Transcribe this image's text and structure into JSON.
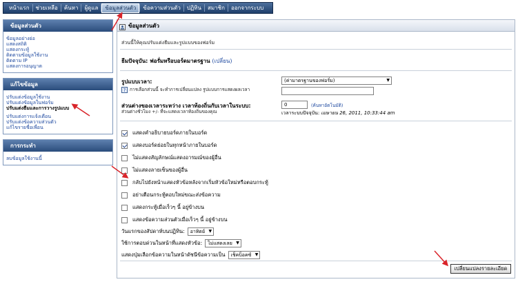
{
  "nav": {
    "items": [
      "หน้าแรก",
      "ช่วยเหลือ",
      "ค้นหา",
      "ผู้ดูแล",
      "ข้อมูลส่วนตัว",
      "ข้อความส่วนตัว",
      "ปฏิทิน",
      "สมาชิก",
      "ออกจากระบบ"
    ],
    "active_index": 4
  },
  "sidebar": {
    "box1": {
      "title": "ข้อมูลส่วนตัว",
      "links": [
        "ข้อมูลอย่างย่อ",
        "แสดงสถิติ",
        "แสดงกระทู้",
        "ติดตามข้อมูลใช้งาน",
        "ติดตาม IP",
        "แสดงการอนุญาต"
      ]
    },
    "box2": {
      "title": "แก้ไขข้อมูล",
      "links_a": [
        "ปรับแต่งข้อมูลใช้งาน",
        "ปรับแต่งข้อมูลในฟอร์ม",
        "ปรับแต่งธีมและการวางรูปแบบ"
      ],
      "links_b": [
        "ปรับแต่งการแจ้งเตือน",
        "ปรับแต่งข้อความส่วนตัว",
        "แก้ไขรายชื่อเพื่อน"
      ]
    },
    "box3": {
      "title": "การกระทำ",
      "links": [
        "ลบข้อมูลใช้งานนี้"
      ]
    }
  },
  "main": {
    "title": "ข้อมูลส่วนตัว",
    "description": "ส่วนนี้ให้คุณปรับแต่งธีมและรูปแบบของฟอร์ม",
    "current_theme_label": "ธีมปัจจุบัน: ฟอรั่มหรือบอร์ดมาตรฐาน",
    "change_link": "(เปลี่ยน)",
    "time_format": {
      "title": "รูปแบบเวลา:",
      "note": "การเลือกส่วนนี้ จะทำการเปลี่ยนแปลง รูปแบบการแสดงผลเวลา",
      "select_value": "(ค่ามาตรฐานของฟอรั่ม)",
      "text_value": ""
    },
    "offset": {
      "title": "ส่วนต่างของเวลาระหว่าง เวลาท้องถิ่นกับเวลาในระบบ:",
      "note": "ส่วนต่างชั่วโมง +/- ที่จะแสดงเวลาท้องถิ่นของคุณ",
      "value": "0",
      "autodetect": "(ค้นหาอัตโนมัติ)",
      "server_time_label": "เวลาระบบปัจจุบัน:",
      "server_time_value": "เมษายน 26, 2011, 10:33:44 am"
    },
    "checkboxes": [
      {
        "label": "แสดงคำอธิบายบอร์ดภายในบอร์ด",
        "checked": true
      },
      {
        "label": "แสดงบอร์ดย่อยในทุกหน้าภายในบอร์ด",
        "checked": true
      },
      {
        "label": "ไม่แสดงสัญลักษณ์แสดงอารมณ์ของผู้อื่น",
        "checked": false
      },
      {
        "label": "ไม่แสดงลายเซ็นของผู้อื่น",
        "checked": false
      },
      {
        "label": "กลับไปยังหน้าแสดงหัวข้อหลังจากเริ่มหัวข้อใหม่หรือตอบกระทู้",
        "checked": false
      },
      {
        "label": "อย่าเตือนกระทู้ตอบใหม่ขณะส่งข้อความ",
        "checked": false
      },
      {
        "label": "แสดงกระทู้เมื่อเร็วๆ นี้ อยู่ข้างบน",
        "checked": false
      },
      {
        "label": "แสดงข้อความส่วนตัวเมื่อเร็วๆ นี้ อยู่ข้างบน",
        "checked": false
      }
    ],
    "first_day": {
      "label": "วันแรกของสัปดาห์บนปฏิทิน:",
      "value": "อาทิตย์"
    },
    "quick_reply": {
      "label": "ใช้การตอบด่วนในหน้าที่แสดงหัวข้อ:",
      "value": "ไม่แสดงเลย"
    },
    "quick_mod": {
      "label": "แสดงปุ่มเลือกข้อความในหน้าดัชนีข้อความเป็น",
      "value": "เช็คบ็อคซ์"
    },
    "submit_label": "เปลี่ยนแปลงรายละเอียด"
  },
  "colors": {
    "nav_dark": "#1f3f6b",
    "link": "#1f4aa0",
    "annotation": "#d9242a"
  }
}
